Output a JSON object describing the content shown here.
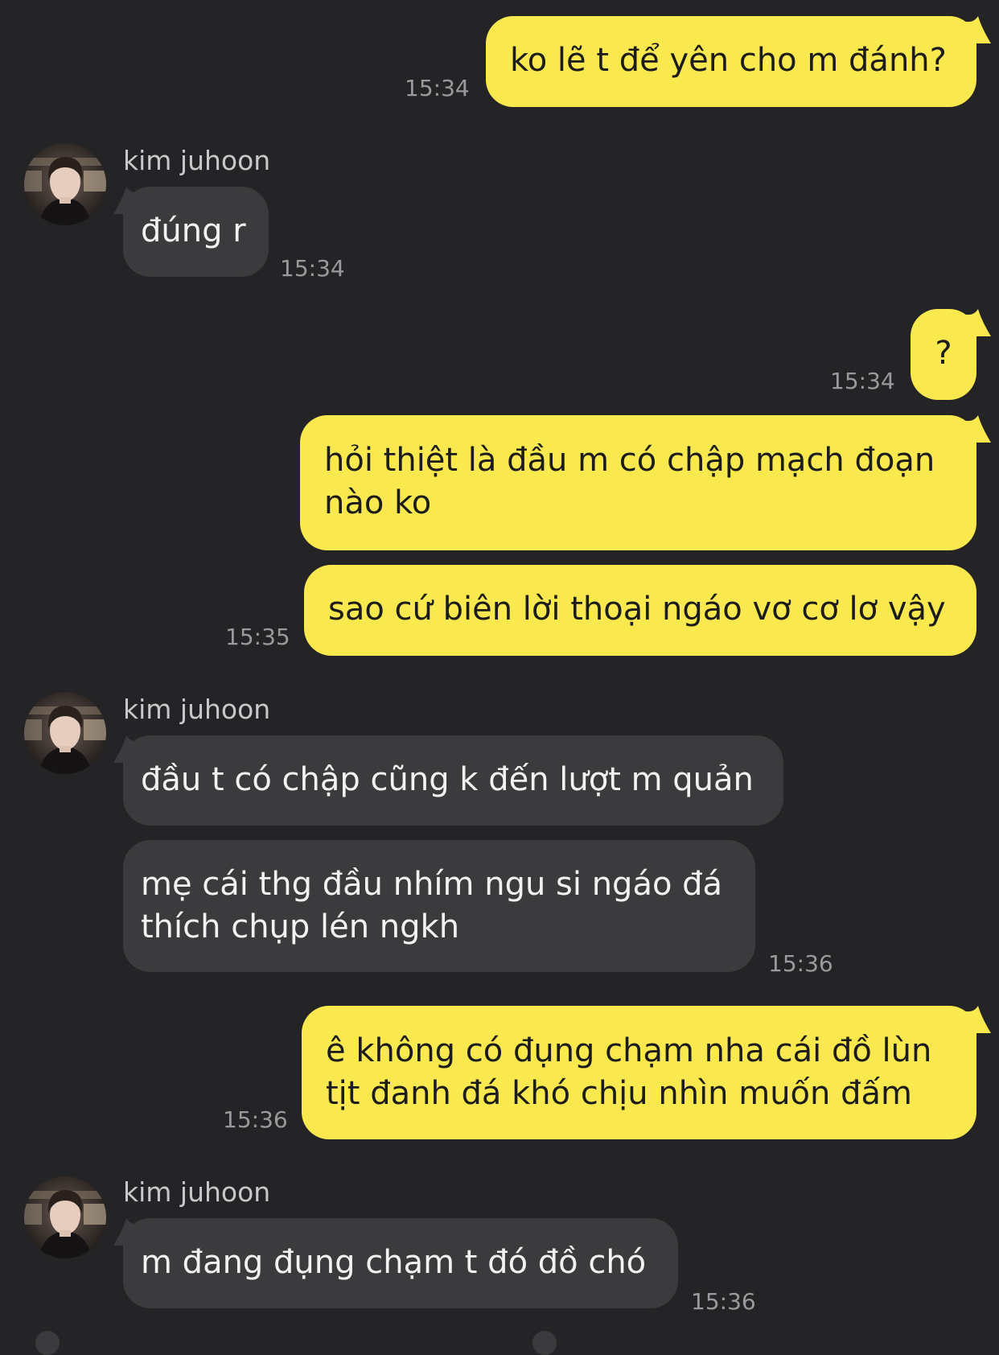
{
  "contact": {
    "name": "kim juhoon",
    "avatar_icon": "profile-photo-avatar"
  },
  "colors": {
    "background": "#242426",
    "outgoing_bubble": "#fae84f",
    "incoming_bubble": "#3b3b3d",
    "timestamp": "#9a9a9c"
  },
  "messages": [
    {
      "from": "me",
      "lines": [
        "ko lẽ t để yên cho m đánh?"
      ],
      "time": "15:34"
    },
    {
      "from": "them",
      "sender": "kim juhoon",
      "lines": [
        "đúng r"
      ],
      "time": "15:34"
    },
    {
      "from": "me",
      "lines": [
        "?"
      ],
      "time": "15:34"
    },
    {
      "from": "me",
      "lines": [
        "hỏi thiệt là đầu m có chập mạch đoạn",
        "nào ko"
      ]
    },
    {
      "from": "me",
      "lines": [
        "sao cứ biên lời thoại ngáo vơ cơ lơ vậy"
      ],
      "time": "15:35"
    },
    {
      "from": "them",
      "sender": "kim juhoon",
      "lines": [
        "đầu t có chập cũng k đến lượt m quản"
      ]
    },
    {
      "from": "them",
      "lines": [
        "mẹ cái thg đầu nhím ngu si ngáo đá",
        "thích chụp lén ngkh"
      ],
      "time": "15:36"
    },
    {
      "from": "me",
      "lines": [
        "ê không có đụng chạm nha cái đồ lùn",
        "tịt đanh đá khó chịu nhìn muốn đấm"
      ],
      "time": "15:36"
    },
    {
      "from": "them",
      "sender": "kim juhoon",
      "lines": [
        "m đang đụng chạm t đó đồ chó"
      ],
      "time": "15:36"
    }
  ]
}
